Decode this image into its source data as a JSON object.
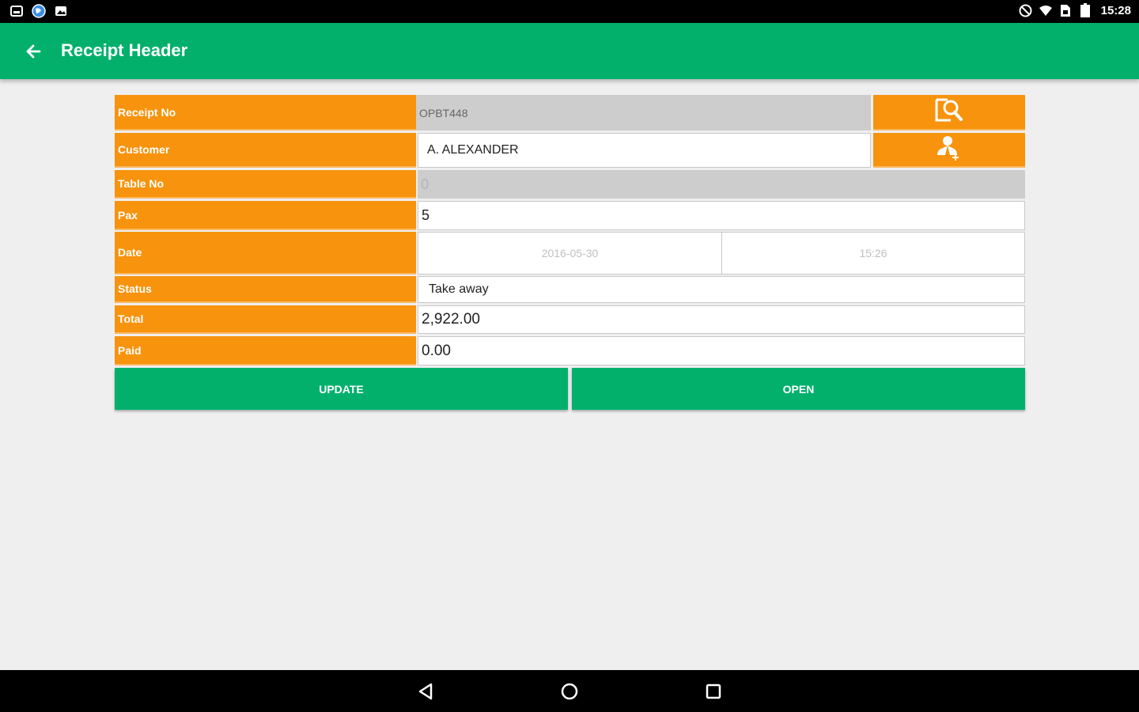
{
  "status_bar": {
    "time": "15:28",
    "icons": [
      "screenshot-icon",
      "globe-icon",
      "gallery-icon",
      "do-not-disturb-icon",
      "wifi-icon",
      "sim-icon",
      "battery-icon"
    ]
  },
  "app_bar": {
    "title": "Receipt Header",
    "back_icon": "arrow-left-icon",
    "color": "#02b06c"
  },
  "form": {
    "label_color": "#f7930d",
    "receipt_no": {
      "label": "Receipt No",
      "value": "OPBT448",
      "action_icon": "receipt-search-icon"
    },
    "customer": {
      "label": "Customer",
      "value": "A. ALEXANDER",
      "action_icon": "add-user-icon"
    },
    "table_no": {
      "label": "Table No",
      "value": "0"
    },
    "pax": {
      "label": "Pax",
      "value": "5"
    },
    "date": {
      "label": "Date",
      "date_value": "2016-05-30",
      "time_value": "15:26"
    },
    "status": {
      "label": "Status",
      "value": "Take away"
    },
    "total": {
      "label": "Total",
      "value": "2,922.00"
    },
    "paid": {
      "label": "Paid",
      "value": "0.00"
    }
  },
  "actions": {
    "update_label": "UPDATE",
    "open_label": "OPEN"
  },
  "nav_bar": {
    "icons": [
      "back-triangle-icon",
      "home-circle-icon",
      "recents-square-icon"
    ]
  }
}
